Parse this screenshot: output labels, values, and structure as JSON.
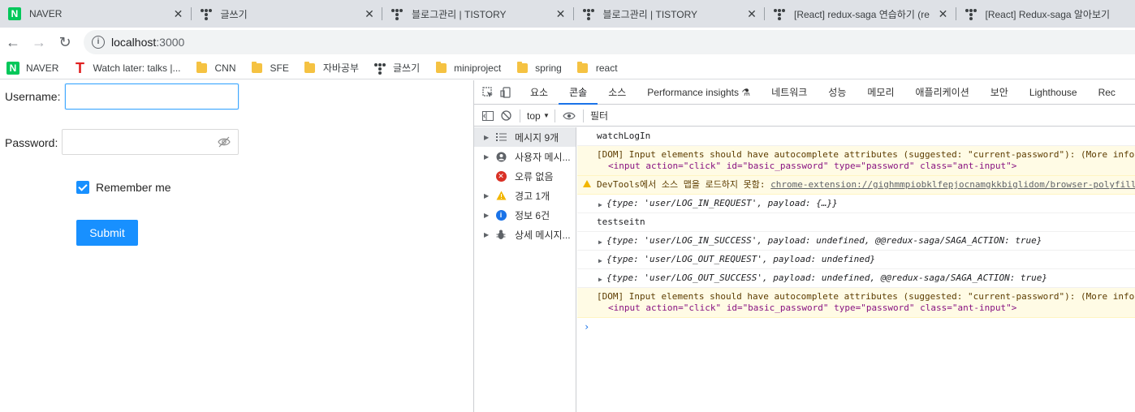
{
  "tabs": [
    {
      "title": "NAVER",
      "icon": "naver-icon"
    },
    {
      "title": "글쓰기",
      "icon": "tistory-icon"
    },
    {
      "title": "블로그관리 | TISTORY",
      "icon": "tistory-icon"
    },
    {
      "title": "블로그관리 | TISTORY",
      "icon": "tistory-icon"
    },
    {
      "title": "[React] redux-saga 연습하기 (re",
      "icon": "tistory-icon"
    },
    {
      "title": "[React] Redux-saga 알아보기",
      "icon": "tistory-icon"
    }
  ],
  "toolbar": {
    "url_host": "localhost",
    "url_port": ":3000"
  },
  "bookmarks": [
    {
      "label": "NAVER",
      "icon": "naver-icon"
    },
    {
      "label": "Watch later: talks |...",
      "icon": "tstory-icon"
    },
    {
      "label": "CNN",
      "icon": "folder-icon"
    },
    {
      "label": "SFE",
      "icon": "folder-icon"
    },
    {
      "label": "자바공부",
      "icon": "folder-icon"
    },
    {
      "label": "글쓰기",
      "icon": "tistory-icon"
    },
    {
      "label": "miniproject",
      "icon": "folder-icon"
    },
    {
      "label": "spring",
      "icon": "folder-icon"
    },
    {
      "label": "react",
      "icon": "folder-icon"
    }
  ],
  "form": {
    "username_label": "Username",
    "password_label": "Password",
    "username_value": "",
    "password_value": "",
    "remember_label": "Remember me",
    "remember_checked": true,
    "submit_label": "Submit"
  },
  "devtools": {
    "tabs": [
      "요소",
      "콘솔",
      "소스",
      "Performance insights",
      "네트워크",
      "성능",
      "메모리",
      "애플리케이션",
      "보안",
      "Lighthouse",
      "Rec"
    ],
    "active_tab": "콘솔",
    "context": "top",
    "filter_placeholder": "필터",
    "sidebar": [
      {
        "label": "메시지 9개",
        "icon": "list-icon",
        "selected": true
      },
      {
        "label": "사용자 메시...",
        "icon": "user-icon",
        "selected": false
      },
      {
        "label": "오류 없음",
        "icon": "error-icon",
        "selected": false
      },
      {
        "label": "경고 1개",
        "icon": "warning-icon",
        "selected": false
      },
      {
        "label": "정보 6건",
        "icon": "info-icon",
        "selected": false
      },
      {
        "label": "상세 메시지...",
        "icon": "bug-icon",
        "selected": false
      }
    ],
    "console": {
      "m1": "watchLogIn",
      "m2_prefix": "[DOM] Input elements should have autocomplete attributes (suggested: \"current-password\"): (More info: ",
      "m2_code": "<input action=\"click\" id=\"basic_password\" type=\"password\" class=\"ant-input\">",
      "m3_prefix": "DevTools에서 소스 맵을 로드하지 못함: ",
      "m3_link": "chrome-extension://gighmmpiobklfepjocnamgkkbiglidom/browser-polyfill",
      "m4": "{type: 'user/LOG_IN_REQUEST', payload: {…}}",
      "m5": "testseitn",
      "m6": "{type: 'user/LOG_IN_SUCCESS', payload: undefined, @@redux-saga/SAGA_ACTION: true}",
      "m7": "{type: 'user/LOG_OUT_REQUEST', payload: undefined}",
      "m8": "{type: 'user/LOG_OUT_SUCCESS', payload: undefined, @@redux-saga/SAGA_ACTION: true}",
      "m9_prefix": "[DOM] Input elements should have autocomplete attributes (suggested: \"current-password\"): (More info: ",
      "m9_code": "<input action=\"click\" id=\"basic_password\" type=\"password\" class=\"ant-input\">",
      "prompt": "›"
    }
  }
}
